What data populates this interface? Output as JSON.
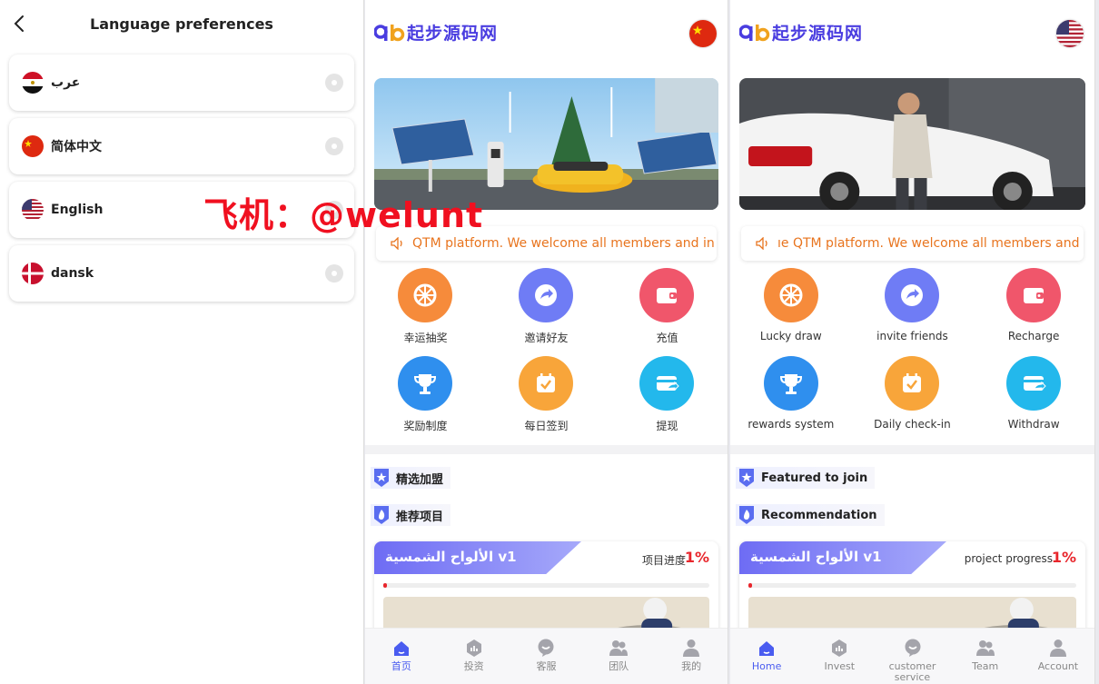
{
  "language_page": {
    "title": "Language preferences",
    "items": [
      {
        "label": "عرب",
        "flag": "egypt-flag-icon"
      },
      {
        "label": "简体中文",
        "flag": "china-flag-icon"
      },
      {
        "label": "English",
        "flag": "usa-flag-icon"
      },
      {
        "label": "dansk",
        "flag": "denmark-flag-icon"
      }
    ],
    "watermark": "飞机：@welunt"
  },
  "home_cn": {
    "logo_text": "起步源码网",
    "notice": "QTM platform. We welcome all members and in",
    "grid": [
      {
        "label": "幸运抽奖",
        "icon": "wheel-icon",
        "color": "#f68b3b"
      },
      {
        "label": "邀请好友",
        "icon": "share-arrow-icon",
        "color": "#6f7cf5"
      },
      {
        "label": "充值",
        "icon": "wallet-icon",
        "color": "#f0566b"
      },
      {
        "label": "奖励制度",
        "icon": "trophy-icon",
        "color": "#2f8fee"
      },
      {
        "label": "每日签到",
        "icon": "calendar-check-icon",
        "color": "#f8a53a"
      },
      {
        "label": "提现",
        "icon": "card-icon",
        "color": "#23b8ec"
      }
    ],
    "section_featured": "精选加盟",
    "section_recommend": "推荐项目",
    "project": {
      "name": "الألواح الشمسية v1",
      "progress_label": "项目进度",
      "progress_value": "1%",
      "progress": 1
    },
    "tabs": [
      {
        "label": "首页",
        "icon": "home-icon"
      },
      {
        "label": "投资",
        "icon": "invest-icon"
      },
      {
        "label": "客服",
        "icon": "chat-icon"
      },
      {
        "label": "团队",
        "icon": "team-icon"
      },
      {
        "label": "我的",
        "icon": "account-icon"
      }
    ]
  },
  "home_en": {
    "logo_text": "起步源码网",
    "notice": "ıe QTM platform. We welcome all members and",
    "grid": [
      {
        "label": "Lucky draw",
        "icon": "wheel-icon",
        "color": "#f68b3b"
      },
      {
        "label": "invite friends",
        "icon": "share-arrow-icon",
        "color": "#6f7cf5"
      },
      {
        "label": "Recharge",
        "icon": "wallet-icon",
        "color": "#f0566b"
      },
      {
        "label": "rewards system",
        "icon": "trophy-icon",
        "color": "#2f8fee"
      },
      {
        "label": "Daily check-in",
        "icon": "calendar-check-icon",
        "color": "#f8a53a"
      },
      {
        "label": "Withdraw",
        "icon": "card-icon",
        "color": "#23b8ec"
      }
    ],
    "section_featured": "Featured to join",
    "section_recommend": "Recommendation",
    "project": {
      "name": "الألواح الشمسية v1",
      "progress_label": "project progress",
      "progress_value": "1%",
      "progress": 1
    },
    "tabs": [
      {
        "label": "Home",
        "icon": "home-icon"
      },
      {
        "label": "Invest",
        "icon": "invest-icon"
      },
      {
        "label": "customer service",
        "icon": "chat-icon"
      },
      {
        "label": "Team",
        "icon": "team-icon"
      },
      {
        "label": "Account",
        "icon": "account-icon"
      }
    ]
  },
  "colors": {
    "accent": "#4a5cf0",
    "notice": "#e8741e",
    "progress": "#e8262c",
    "logo": "#4a3de0"
  }
}
